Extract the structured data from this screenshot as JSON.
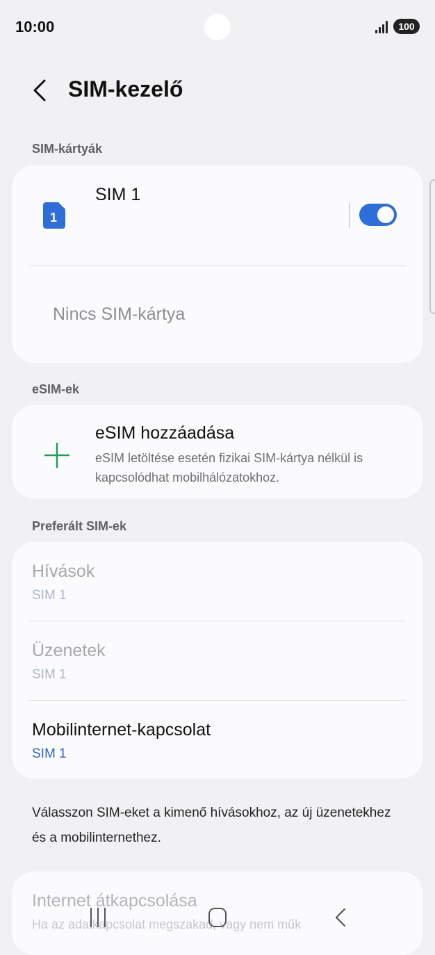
{
  "status": {
    "time": "10:00",
    "battery": "100"
  },
  "header": {
    "title": "SIM-kezelő"
  },
  "sections": {
    "sim_cards": "SIM-kártyák",
    "esims": "eSIM-ek",
    "preferred": "Preferált SIM-ek"
  },
  "sim_card": {
    "slot_number": "1",
    "name": "SIM 1",
    "enabled": true,
    "empty_slot": "Nincs SIM-kártya"
  },
  "esim": {
    "add_title": "eSIM hozzáadása",
    "add_description": "eSIM letöltése esetén fizikai SIM-kártya nélkül is kapcsolódhat mobilhálózatokhoz."
  },
  "preferred": {
    "calls": {
      "label": "Hívások",
      "value": "SIM 1"
    },
    "messages": {
      "label": "Üzenetek",
      "value": "SIM 1"
    },
    "mobile_data": {
      "label": "Mobilinternet-kapcsolat",
      "value": "SIM 1"
    }
  },
  "footnote": "Válasszon SIM-eket a kimenő hívásokhoz, az új üzenetekhez és a mobilinternethez.",
  "internet_switch": {
    "title": "Internet átkapcsolása",
    "subtitle": "Ha az adatkapcsolat megszakad, vagy nem műk"
  },
  "colors": {
    "accent": "#2d6ed9",
    "plus": "#1f9d55",
    "background": "#f1f1f4",
    "card": "#fbfbfd"
  }
}
